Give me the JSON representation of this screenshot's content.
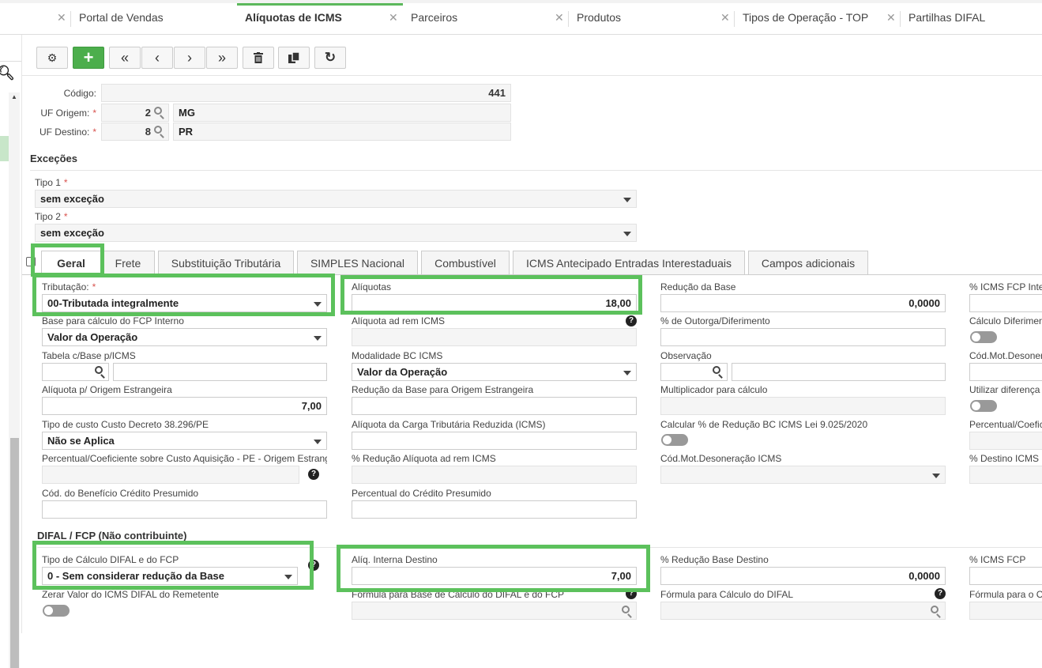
{
  "tabs": [
    {
      "label": "Portal de Vendas"
    },
    {
      "label": "Alíquotas de ICMS"
    },
    {
      "label": "Parceiros"
    },
    {
      "label": "Produtos"
    },
    {
      "label": "Tipos de Operação - TOP"
    },
    {
      "label": "Partilhas DIFAL"
    }
  ],
  "tab_close": "✕",
  "header": {
    "codigo_label": "Código:",
    "codigo_value": "441",
    "uf_origem_label": "UF Origem:",
    "uf_origem_code": "2",
    "uf_origem_name": "MG",
    "uf_destino_label": "UF Destino:",
    "uf_destino_code": "8",
    "uf_destino_name": "PR",
    "required_mark": "*"
  },
  "excecoes": {
    "title": "Exceções",
    "tipo1_label": "Tipo 1",
    "tipo1_value": "sem exceção",
    "tipo2_label": "Tipo 2",
    "tipo2_value": "sem exceção"
  },
  "form_tabs": [
    "Geral",
    "Frete",
    "Substituição Tributária",
    "SIMPLES Nacional",
    "Combustível",
    "ICMS Antecipado Entradas Interestaduais",
    "Campos adicionais"
  ],
  "geral": {
    "tributacao_label": "Tributação:",
    "tributacao_value": "00-Tributada integralmente",
    "aliquotas_label": "Alíquotas",
    "aliquotas_value": "18,00",
    "reducao_base_label": "Redução da Base",
    "reducao_base_value": "0,0000",
    "icms_fcp_inte_label": "% ICMS FCP Inte",
    "base_fcp_label": "Base para cálculo do FCP Interno",
    "base_fcp_value": "Valor da Operação",
    "aliq_ad_rem_label": "Alíquota ad rem ICMS",
    "outorga_label": "% de Outorga/Diferimento",
    "calc_diferim_label": "Cálculo Diferimen",
    "tabela_base_label": "Tabela c/Base p/ICMS",
    "modalidade_label": "Modalidade BC ICMS",
    "modalidade_value": "Valor da Operação",
    "observacao_label": "Observação",
    "cod_mot_desoner_label": "Cód.Mot.Desoner",
    "aliq_origem_estr_label": "Alíquota p/ Origem Estrangeira",
    "aliq_origem_estr_value": "7,00",
    "red_base_origem_label": "Redução da Base para Origem Estrangeira",
    "multiplicador_label": "Multiplicador para cálculo",
    "utilizar_diferenca_label": "Utilizar diferença",
    "tipo_custo_label": "Tipo de custo Custo Decreto 38.296/PE",
    "tipo_custo_value": "Não se Aplica",
    "aliq_carga_label": "Alíquota da Carga Tributária Reduzida (ICMS)",
    "calc_red_bc_label": "Calcular % de Redução BC ICMS Lei 9.025/2020",
    "percentual_coef_label": "Percentual/Coefic",
    "perc_coef_custo_label": "Percentual/Coeficiente sobre Custo Aquisição - PE - Origem Estrang",
    "red_aliq_ad_rem_label": "% Redução Alíquota ad rem ICMS",
    "cod_mot_desoneracao_label": "Cód.Mot.Desoneração ICMS",
    "destino_icms_label": "% Destino ICMS I",
    "cod_beneficio_label": "Cód. do Benefício Crédito Presumido",
    "perc_credito_label": "Percentual do Crédito Presumido",
    "help_icon": "?"
  },
  "difal": {
    "title": "DIFAL / FCP (Não contribuinte)",
    "tipo_calc_label": "Tipo de Cálculo DIFAL e do FCP",
    "tipo_calc_value": "0 - Sem considerar redução da Base",
    "aliq_interna_label": "Alíq. Interna Destino",
    "aliq_interna_value": "7,00",
    "red_base_destino_label": "% Redução Base Destino",
    "red_base_destino_value": "0,0000",
    "icms_fcp_label": "% ICMS FCP",
    "zerar_label": "Zerar Valor do ICMS DIFAL do Remetente",
    "formula_base_label": "Fórmula para Base de Cálculo do DIFAL e do FCP",
    "formula_calc_label": "Fórmula para Cálculo do DIFAL",
    "formula_para_label": "Fórmula para o C"
  },
  "colors": {
    "accent": "#5cb85c",
    "highlight": "#5cc15c",
    "required": "#d9534f"
  }
}
